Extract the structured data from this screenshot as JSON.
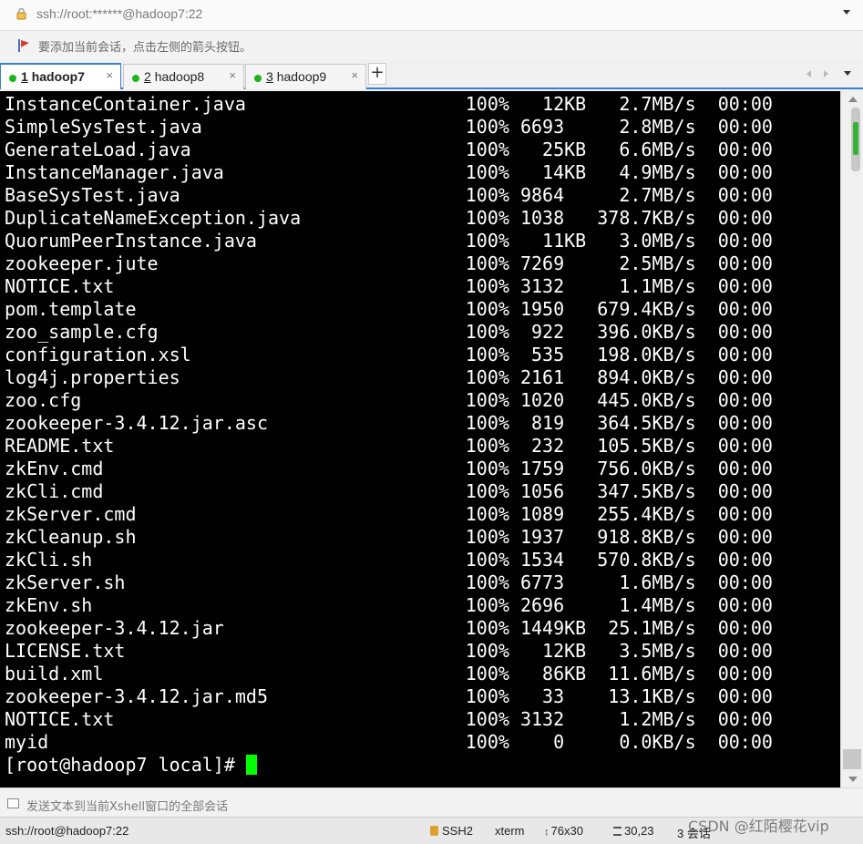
{
  "address_bar": {
    "text": "ssh://root:******@hadoop7:22"
  },
  "hint_bar": {
    "text": "要添加当前会话，点击左侧的箭头按钮。"
  },
  "tabs": [
    {
      "num": "1",
      "label": "hadoop7",
      "close": "×",
      "status_color": "#1cb51c"
    },
    {
      "num": "2",
      "label": "hadoop8",
      "close": "×",
      "status_color": "#1cb51c"
    },
    {
      "num": "3",
      "label": "hadoop9",
      "close": "×",
      "status_color": "#1cb51c"
    }
  ],
  "tab_add_label": "+",
  "terminal": {
    "lines": [
      {
        "name": "InstanceContainer.java",
        "pct": "100%",
        "size": "  12KB",
        "speed": "  2.7MB/s",
        "time": "00:00"
      },
      {
        "name": "SimpleSysTest.java",
        "pct": "100%",
        "size": "6693  ",
        "speed": "  2.8MB/s",
        "time": "00:00"
      },
      {
        "name": "GenerateLoad.java",
        "pct": "100%",
        "size": "  25KB",
        "speed": "  6.6MB/s",
        "time": "00:00"
      },
      {
        "name": "InstanceManager.java",
        "pct": "100%",
        "size": "  14KB",
        "speed": "  4.9MB/s",
        "time": "00:00"
      },
      {
        "name": "BaseSysTest.java",
        "pct": "100%",
        "size": "9864  ",
        "speed": "  2.7MB/s",
        "time": "00:00"
      },
      {
        "name": "DuplicateNameException.java",
        "pct": "100%",
        "size": "1038  ",
        "speed": "378.7KB/s",
        "time": "00:00"
      },
      {
        "name": "QuorumPeerInstance.java",
        "pct": "100%",
        "size": "  11KB",
        "speed": "  3.0MB/s",
        "time": "00:00"
      },
      {
        "name": "zookeeper.jute",
        "pct": "100%",
        "size": "7269  ",
        "speed": "  2.5MB/s",
        "time": "00:00"
      },
      {
        "name": "NOTICE.txt",
        "pct": "100%",
        "size": "3132  ",
        "speed": "  1.1MB/s",
        "time": "00:00"
      },
      {
        "name": "pom.template",
        "pct": "100%",
        "size": "1950  ",
        "speed": "679.4KB/s",
        "time": "00:00"
      },
      {
        "name": "zoo_sample.cfg",
        "pct": "100%",
        "size": " 922  ",
        "speed": "396.0KB/s",
        "time": "00:00"
      },
      {
        "name": "configuration.xsl",
        "pct": "100%",
        "size": " 535  ",
        "speed": "198.0KB/s",
        "time": "00:00"
      },
      {
        "name": "log4j.properties",
        "pct": "100%",
        "size": "2161  ",
        "speed": "894.0KB/s",
        "time": "00:00"
      },
      {
        "name": "zoo.cfg",
        "pct": "100%",
        "size": "1020  ",
        "speed": "445.0KB/s",
        "time": "00:00"
      },
      {
        "name": "zookeeper-3.4.12.jar.asc",
        "pct": "100%",
        "size": " 819  ",
        "speed": "364.5KB/s",
        "time": "00:00"
      },
      {
        "name": "README.txt",
        "pct": "100%",
        "size": " 232  ",
        "speed": "105.5KB/s",
        "time": "00:00"
      },
      {
        "name": "zkEnv.cmd",
        "pct": "100%",
        "size": "1759  ",
        "speed": "756.0KB/s",
        "time": "00:00"
      },
      {
        "name": "zkCli.cmd",
        "pct": "100%",
        "size": "1056  ",
        "speed": "347.5KB/s",
        "time": "00:00"
      },
      {
        "name": "zkServer.cmd",
        "pct": "100%",
        "size": "1089  ",
        "speed": "255.4KB/s",
        "time": "00:00"
      },
      {
        "name": "zkCleanup.sh",
        "pct": "100%",
        "size": "1937  ",
        "speed": "918.8KB/s",
        "time": "00:00"
      },
      {
        "name": "zkCli.sh",
        "pct": "100%",
        "size": "1534  ",
        "speed": "570.8KB/s",
        "time": "00:00"
      },
      {
        "name": "zkServer.sh",
        "pct": "100%",
        "size": "6773  ",
        "speed": "  1.6MB/s",
        "time": "00:00"
      },
      {
        "name": "zkEnv.sh",
        "pct": "100%",
        "size": "2696  ",
        "speed": "  1.4MB/s",
        "time": "00:00"
      },
      {
        "name": "zookeeper-3.4.12.jar",
        "pct": "100%",
        "size": "1449KB",
        "speed": " 25.1MB/s",
        "time": "00:00"
      },
      {
        "name": "LICENSE.txt",
        "pct": "100%",
        "size": "  12KB",
        "speed": "  3.5MB/s",
        "time": "00:00"
      },
      {
        "name": "build.xml",
        "pct": "100%",
        "size": "  86KB",
        "speed": " 11.6MB/s",
        "time": "00:00"
      },
      {
        "name": "zookeeper-3.4.12.jar.md5",
        "pct": "100%",
        "size": "  33  ",
        "speed": " 13.1KB/s",
        "time": "00:00"
      },
      {
        "name": "NOTICE.txt",
        "pct": "100%",
        "size": "3132  ",
        "speed": "  1.2MB/s",
        "time": "00:00"
      },
      {
        "name": "myid",
        "pct": "100%",
        "size": "   0  ",
        "speed": "  0.0KB/s",
        "time": "00:00"
      }
    ],
    "prompt": "[root@hadoop7 local]# ",
    "cursor_color": "#00ff00"
  },
  "compose_bar": {
    "text": "发送文本到当前Xshell窗口的全部会话"
  },
  "status_bar": {
    "connection": "ssh://root@hadoop7:22",
    "protocol": "SSH2",
    "terminal_type": "xterm",
    "size": "76x30",
    "cursor_pos": "30,23",
    "sessions": "3 会话",
    "watermark": "CSDN @红陌樱花vip"
  }
}
